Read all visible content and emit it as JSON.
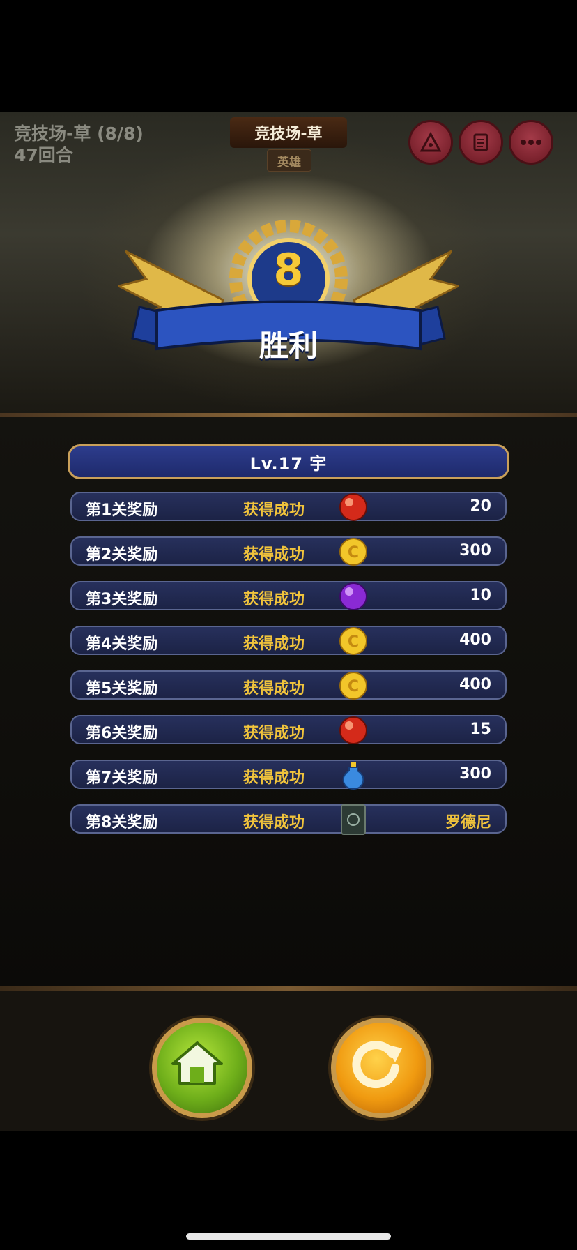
{
  "header": {
    "stage_name": "竞技场-草 (8/8)",
    "round_count": "47回合",
    "arena_title": "竞技场-草",
    "difficulty": "英雄",
    "buttons": [
      "triangle-icon",
      "scroll-icon",
      "more-icon"
    ]
  },
  "result": {
    "rank": "8",
    "victory_label": "胜利"
  },
  "rewards": {
    "title": "Lv.17  宇",
    "rows": [
      {
        "label": "第1关奖励",
        "status": "获得成功",
        "icon": "red-orb-icon",
        "amount": "20"
      },
      {
        "label": "第2关奖励",
        "status": "获得成功",
        "icon": "gold-coin-icon",
        "amount": "300"
      },
      {
        "label": "第3关奖励",
        "status": "获得成功",
        "icon": "purple-orb-icon",
        "amount": "10"
      },
      {
        "label": "第4关奖励",
        "status": "获得成功",
        "icon": "gold-coin-icon",
        "amount": "400"
      },
      {
        "label": "第5关奖励",
        "status": "获得成功",
        "icon": "gold-coin-icon",
        "amount": "400"
      },
      {
        "label": "第6关奖励",
        "status": "获得成功",
        "icon": "red-orb-icon",
        "amount": "15"
      },
      {
        "label": "第7关奖励",
        "status": "获得成功",
        "icon": "blue-potion-icon",
        "amount": "300"
      },
      {
        "label": "第8关奖励",
        "status": "获得成功",
        "icon": "hero-card-icon",
        "amount": "罗德尼"
      }
    ]
  },
  "actions": {
    "home": "home-icon",
    "retry": "retry-icon"
  },
  "colors": {
    "accent_gold": "#f0c33c",
    "panel_blue": "#1e2a6c",
    "home_green": "#6eae1a",
    "retry_orange": "#f09a10"
  }
}
